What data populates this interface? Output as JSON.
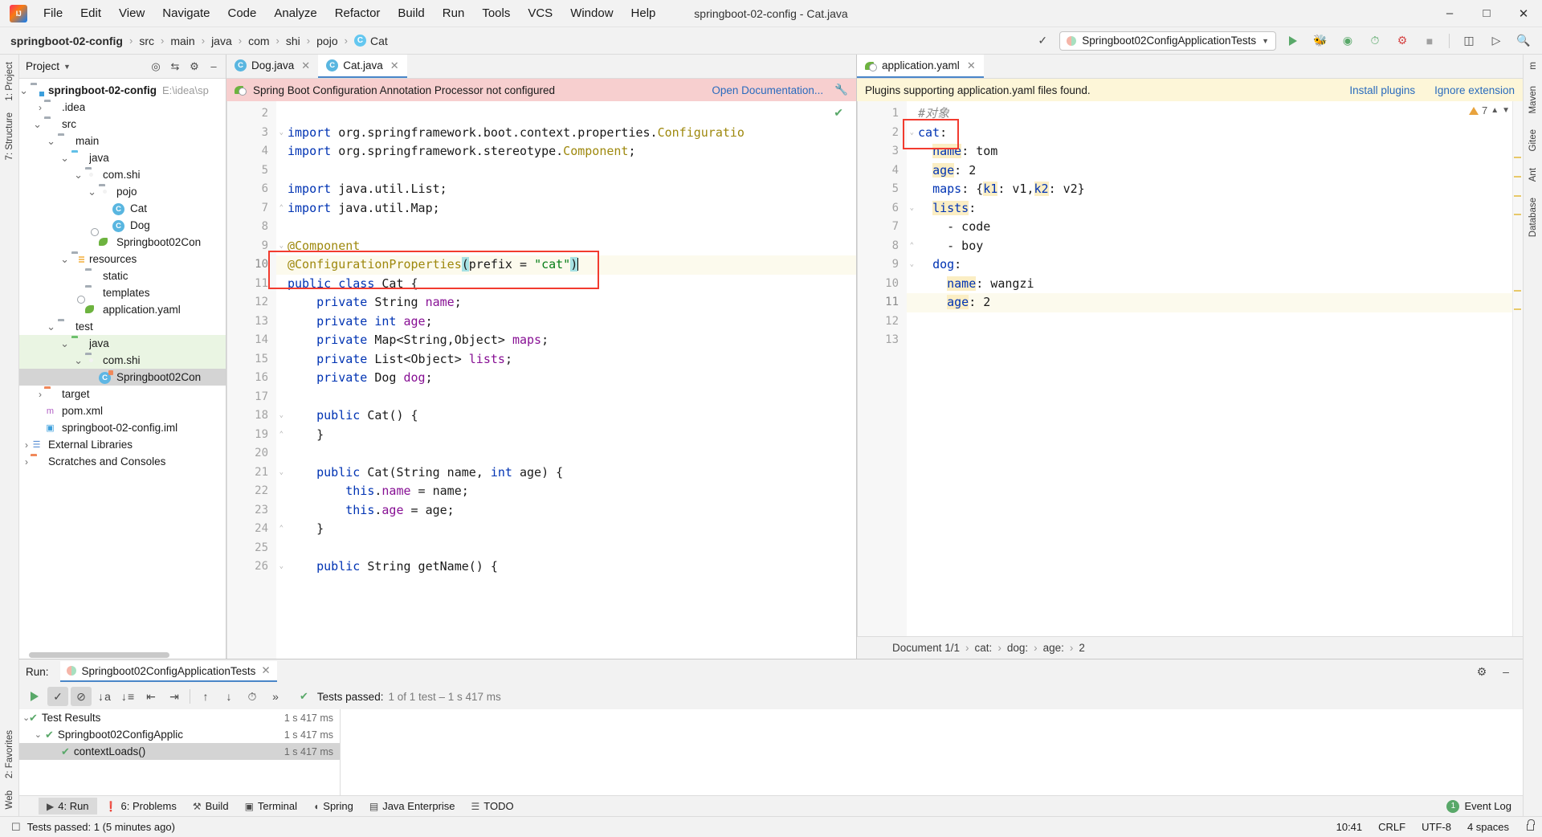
{
  "window": {
    "title": "springboot-02-config - Cat.java",
    "logo_icon": "intellij-idea-logo",
    "minimize_icon": "minimize-icon",
    "maximize_icon": "maximize-icon",
    "close_icon": "close-icon"
  },
  "menu": [
    "File",
    "Edit",
    "View",
    "Navigate",
    "Code",
    "Analyze",
    "Refactor",
    "Build",
    "Run",
    "Tools",
    "VCS",
    "Window",
    "Help"
  ],
  "breadcrumb": {
    "project": "springboot-02-config",
    "parts": [
      "src",
      "main",
      "java",
      "com",
      "shi",
      "pojo"
    ],
    "file": "Cat",
    "file_badge": "C"
  },
  "toolbar": {
    "build_icon": "hammer-icon",
    "run_config": "Springboot02ConfigApplicationTests",
    "dropdown_icon": "chevron-down-icon",
    "run_icon": "run-icon",
    "debug_icon": "debug-icon",
    "run_coverage_icon": "run-with-coverage-icon",
    "profiler_icon": "profiler-icon",
    "stop_icon": "stop-icon",
    "update_icon": "update-running-app-icon",
    "services_icon": "services-icon",
    "search_icon": "search-everywhere-icon"
  },
  "left_rail": {
    "top": [
      "1: Project",
      "7: Structure"
    ],
    "bottom": [
      "2: Favorites",
      "Web"
    ]
  },
  "right_rail": [
    "m",
    "Maven",
    "Gitee",
    "Ant",
    "Database"
  ],
  "project_panel": {
    "title": "Project",
    "caret_icon": "chevron-down-icon",
    "actions": [
      "target-icon",
      "collapse-all-icon",
      "settings-gear-icon",
      "hide-icon"
    ],
    "tree": [
      {
        "depth": 0,
        "arrow": "v",
        "icon": "folder-module",
        "label": "springboot-02-config",
        "bold": true,
        "path": "E:\\idea\\sp",
        "state": ""
      },
      {
        "depth": 1,
        "arrow": ">",
        "icon": "folder",
        "label": ".idea",
        "bold": false,
        "path": "",
        "state": ""
      },
      {
        "depth": 1,
        "arrow": "v",
        "icon": "folder",
        "label": "src",
        "bold": false,
        "path": "",
        "state": ""
      },
      {
        "depth": 2,
        "arrow": "v",
        "icon": "folder",
        "label": "main",
        "bold": false,
        "path": "",
        "state": ""
      },
      {
        "depth": 3,
        "arrow": "v",
        "icon": "folder-source",
        "label": "java",
        "bold": false,
        "path": "",
        "state": ""
      },
      {
        "depth": 4,
        "arrow": "v",
        "icon": "folder-package",
        "label": "com.shi",
        "bold": false,
        "path": "",
        "state": ""
      },
      {
        "depth": 5,
        "arrow": "v",
        "icon": "folder-package",
        "label": "pojo",
        "bold": false,
        "path": "",
        "state": ""
      },
      {
        "depth": 6,
        "arrow": "",
        "icon": "java-class",
        "label": "Cat",
        "bold": false,
        "path": "",
        "state": ""
      },
      {
        "depth": 6,
        "arrow": "",
        "icon": "java-class",
        "label": "Dog",
        "bold": false,
        "path": "",
        "state": ""
      },
      {
        "depth": 5,
        "arrow": "",
        "icon": "spring-boot-class",
        "label": "Springboot02Con",
        "bold": false,
        "path": "",
        "state": ""
      },
      {
        "depth": 3,
        "arrow": "v",
        "icon": "folder-resources",
        "label": "resources",
        "bold": false,
        "path": "",
        "state": ""
      },
      {
        "depth": 4,
        "arrow": "",
        "icon": "folder",
        "label": "static",
        "bold": false,
        "path": "",
        "state": ""
      },
      {
        "depth": 4,
        "arrow": "",
        "icon": "folder",
        "label": "templates",
        "bold": false,
        "path": "",
        "state": ""
      },
      {
        "depth": 4,
        "arrow": "",
        "icon": "spring-yaml-file",
        "label": "application.yaml",
        "bold": false,
        "path": "",
        "state": ""
      },
      {
        "depth": 2,
        "arrow": "v",
        "icon": "folder",
        "label": "test",
        "bold": false,
        "path": "",
        "state": ""
      },
      {
        "depth": 3,
        "arrow": "v",
        "icon": "folder-test-source",
        "label": "java",
        "bold": false,
        "path": "",
        "state": "green"
      },
      {
        "depth": 4,
        "arrow": "v",
        "icon": "folder-package",
        "label": "com.shi",
        "bold": false,
        "path": "",
        "state": "green"
      },
      {
        "depth": 5,
        "arrow": "",
        "icon": "java-test-class",
        "label": "Springboot02Con",
        "bold": false,
        "path": "",
        "state": "sel"
      },
      {
        "depth": 1,
        "arrow": ">",
        "icon": "folder-excluded",
        "label": "target",
        "bold": false,
        "path": "",
        "state": ""
      },
      {
        "depth": 1,
        "arrow": "",
        "icon": "maven-file",
        "label": "pom.xml",
        "bold": false,
        "path": "",
        "state": ""
      },
      {
        "depth": 1,
        "arrow": "",
        "icon": "module-file",
        "label": "springboot-02-config.iml",
        "bold": false,
        "path": "",
        "state": ""
      },
      {
        "depth": 0,
        "arrow": ">",
        "icon": "external-libraries",
        "label": "External Libraries",
        "bold": false,
        "path": "",
        "state": ""
      },
      {
        "depth": 0,
        "arrow": ">",
        "icon": "scratches",
        "label": "Scratches and Consoles",
        "bold": false,
        "path": "",
        "state": ""
      }
    ]
  },
  "editor_left": {
    "tabs": [
      {
        "label": "Dog.java",
        "badge": "C",
        "active": false,
        "close_icon": "close-icon"
      },
      {
        "label": "Cat.java",
        "badge": "C",
        "active": true,
        "close_icon": "close-icon"
      }
    ],
    "banner": {
      "icon": "spring-boot-icon",
      "text": "Spring Boot Configuration Annotation Processor not configured",
      "link": "Open Documentation...",
      "wrench_icon": "wrench-icon"
    },
    "inspection_icon": "inspection-ok-check",
    "first_line_number": 2,
    "lines": [
      {
        "n": 2,
        "html": "",
        "fold": ""
      },
      {
        "n": 3,
        "html": "<span class=\"kw\">import</span> org.springframework.boot.context.properties.<span class=\"ann\">Configuratio</span>",
        "fold": "minus"
      },
      {
        "n": 4,
        "html": "<span class=\"kw\">import</span> org.springframework.stereotype.<span class=\"ann\">Component</span>;",
        "fold": ""
      },
      {
        "n": 5,
        "html": "",
        "fold": ""
      },
      {
        "n": 6,
        "html": "<span class=\"kw\">import</span> java.util.List;",
        "fold": ""
      },
      {
        "n": 7,
        "html": "<span class=\"kw\">import</span> java.util.Map;",
        "fold": "end"
      },
      {
        "n": 8,
        "html": "",
        "fold": ""
      },
      {
        "n": 9,
        "html": "<span class=\"ann\">@Component</span>",
        "fold": "minus"
      },
      {
        "n": 10,
        "html": "<span class=\"ann\">@ConfigurationProperties</span><span class=\"sel\">(</span><span class=\"typ\">prefix = </span><span class=\"str\">\"cat\"</span><span class=\"sel\">)</span><span class=\"caret\"></span>",
        "fold": "end",
        "hl": true
      },
      {
        "n": 11,
        "html": "<span class=\"kw\">public class</span> Cat {",
        "fold": ""
      },
      {
        "n": 12,
        "html": "    <span class=\"kw\">private</span> String <span class=\"fld\">name</span>;",
        "fold": ""
      },
      {
        "n": 13,
        "html": "    <span class=\"kw\">private</span> <span class=\"kw\">int</span> <span class=\"fld\">age</span>;",
        "fold": ""
      },
      {
        "n": 14,
        "html": "    <span class=\"kw\">private</span> Map&lt;String,Object&gt; <span class=\"fld\">maps</span>;",
        "fold": ""
      },
      {
        "n": 15,
        "html": "    <span class=\"kw\">private</span> List&lt;Object&gt; <span class=\"fld\">lists</span>;",
        "fold": ""
      },
      {
        "n": 16,
        "html": "    <span class=\"kw\">private</span> Dog <span class=\"fld\">dog</span>;",
        "fold": ""
      },
      {
        "n": 17,
        "html": "",
        "fold": ""
      },
      {
        "n": 18,
        "html": "    <span class=\"kw\">public</span> <span class=\"typ\">Cat</span>() {",
        "fold": "minus"
      },
      {
        "n": 19,
        "html": "    }",
        "fold": "end"
      },
      {
        "n": 20,
        "html": "",
        "fold": ""
      },
      {
        "n": 21,
        "html": "    <span class=\"kw\">public</span> <span class=\"typ\">Cat</span>(String name, <span class=\"kw\">int</span> age) {",
        "fold": "minus"
      },
      {
        "n": 22,
        "html": "        <span class=\"kw\">this</span>.<span class=\"fld\">name</span> = name;",
        "fold": ""
      },
      {
        "n": 23,
        "html": "        <span class=\"kw\">this</span>.<span class=\"fld\">age</span> = age;",
        "fold": ""
      },
      {
        "n": 24,
        "html": "    }",
        "fold": "end"
      },
      {
        "n": 25,
        "html": "",
        "fold": ""
      },
      {
        "n": 26,
        "html": "    <span class=\"kw\">public</span> String getName() {",
        "fold": "minus"
      }
    ]
  },
  "editor_right": {
    "tab": {
      "label": "application.yaml",
      "icon": "spring-yaml-icon",
      "close_icon": "close-icon"
    },
    "banner": {
      "text": "Plugins supporting application.yaml files found.",
      "link": "Install plugins",
      "link2": "Ignore extension"
    },
    "warning_count": "7",
    "warning_icon": "warning-triangle-icon",
    "up_icon": "chevron-up-icon",
    "down_icon": "chevron-down-icon",
    "lines": [
      {
        "n": 1,
        "html": "<span class=\"cmt\">#对象</span>",
        "fold": ""
      },
      {
        "n": 2,
        "html": "<span class=\"kw\">cat</span>:",
        "fold": "minus"
      },
      {
        "n": 3,
        "html": "  <span class=\"kw ybrace\">name</span>: tom",
        "fold": ""
      },
      {
        "n": 4,
        "html": "  <span class=\"kw ybrace\">age</span>: 2",
        "fold": ""
      },
      {
        "n": 5,
        "html": "  <span class=\"kw\">maps</span>: {<span class=\"kw ybrace\">k1</span>: v1,<span class=\"kw ybrace\">k2</span>: v2}",
        "fold": ""
      },
      {
        "n": 6,
        "html": "  <span class=\"kw ybrace\">lists</span>:",
        "fold": "minus"
      },
      {
        "n": 7,
        "html": "    - code",
        "fold": ""
      },
      {
        "n": 8,
        "html": "    - boy",
        "fold": "end"
      },
      {
        "n": 9,
        "html": "  <span class=\"kw\">dog</span>:",
        "fold": "minus"
      },
      {
        "n": 10,
        "html": "    <span class=\"kw ybrace\">name</span>: wangzi",
        "fold": ""
      },
      {
        "n": 11,
        "html": "    <span class=\"kw ybrace\">age</span>: 2",
        "fold": "end",
        "hl": true
      },
      {
        "n": 12,
        "html": "",
        "fold": ""
      },
      {
        "n": 13,
        "html": "",
        "fold": ""
      }
    ],
    "breadcrumb": [
      "Document 1/1",
      "cat:",
      "dog:",
      "age:",
      "2"
    ]
  },
  "run_panel": {
    "label": "Run:",
    "tab": "Springboot02ConfigApplicationTests",
    "tab_close_icon": "close-icon",
    "settings_icon": "settings-gear-icon",
    "hide_icon": "hide-icon",
    "toolbar_icons": [
      "rerun-icon",
      "show-passed-icon",
      "hide-ignored-icon",
      "sort-alphabetically-icon",
      "sort-by-duration-icon",
      "expand-all-icon",
      "collapse-all-icon",
      "prev-failed-icon",
      "next-failed-icon",
      "test-history-icon",
      "more-icon"
    ],
    "status_check_icon": "check-icon",
    "status_label": "Tests passed:",
    "status_value": "1 of 1 test – 1 s 417 ms",
    "tree": [
      {
        "depth": 0,
        "arrow": "v",
        "label": "Test Results",
        "time": "1 s 417 ms",
        "sel": false
      },
      {
        "depth": 1,
        "arrow": "v",
        "label": "Springboot02ConfigApplic",
        "time": "1 s 417 ms",
        "sel": false
      },
      {
        "depth": 2,
        "arrow": "",
        "label": "contextLoads()",
        "time": "1 s 417 ms",
        "sel": true
      }
    ]
  },
  "bottom_bar": [
    {
      "label": "4: Run",
      "icon": "run-icon",
      "active": true
    },
    {
      "label": "6: Problems",
      "icon": "problems-icon",
      "active": false
    },
    {
      "label": "Build",
      "icon": "hammer-icon",
      "active": false
    },
    {
      "label": "Terminal",
      "icon": "terminal-icon",
      "active": false
    },
    {
      "label": "Spring",
      "icon": "spring-icon",
      "active": false
    },
    {
      "label": "Java Enterprise",
      "icon": "java-enterprise-icon",
      "active": false
    },
    {
      "label": "TODO",
      "icon": "todo-icon",
      "active": false
    }
  ],
  "status_bar": {
    "icon": "status-message-icon",
    "message": "Tests passed: 1 (5 minutes ago)",
    "event_log": "Event Log",
    "event_badge": "1",
    "position": "10:41",
    "line_sep": "CRLF",
    "encoding": "UTF-8",
    "indent": "4 spaces",
    "lock_icon": "unlocked-icon"
  },
  "colors": {
    "accent_blue": "#4a86c8",
    "keyword": "#0033b3",
    "annotation": "#9e880d",
    "string": "#067d17",
    "field": "#871094",
    "highlight_box": "#f23b2f",
    "success_green": "#59a869",
    "banner_red": "#f7cfcf",
    "banner_yellow": "#fdf6d8"
  }
}
